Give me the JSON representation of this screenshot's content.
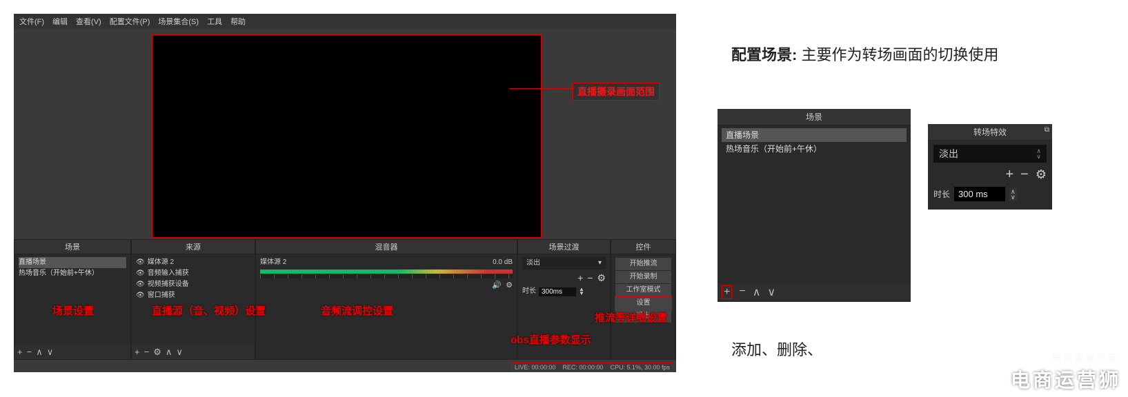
{
  "menu": [
    "文件(F)",
    "编辑",
    "查看(V)",
    "配置文件(P)",
    "场景集合(S)",
    "工具",
    "帮助"
  ],
  "annotations": {
    "preview_range": "直播摄录画面范围",
    "scenes": "场景设置",
    "sources": "直播源（音、视频）设置",
    "mixer": "音频流调控设置",
    "controls": "推流等详细设置",
    "status": "obs直播参数显示"
  },
  "panel_titles": {
    "scenes": "场景",
    "sources": "来源",
    "mixer": "混音器",
    "transitions": "场景过渡",
    "controls": "控件"
  },
  "scenes": {
    "items": [
      "直播场景",
      "热场音乐（开始前+午休）"
    ],
    "active_index": 0
  },
  "sources": {
    "items": [
      {
        "name": "媒体源 2",
        "visible": true
      },
      {
        "name": "音频输入捕获",
        "visible": true
      },
      {
        "name": "视频捕获设备",
        "visible": true
      },
      {
        "name": "窗口捕获",
        "visible": true
      }
    ]
  },
  "mixer": {
    "track_label": "媒体源 2",
    "level": "0.0 dB"
  },
  "transitions": {
    "selected": "淡出",
    "duration_label": "时长",
    "duration_value": "300ms"
  },
  "controls": {
    "buttons": [
      "开始推流",
      "开始录制",
      "工作室模式",
      "设置",
      "退出"
    ],
    "highlight_index": 3
  },
  "statusbar": {
    "live": "LIVE: 00:00:00",
    "rec": "REC: 00:00:00",
    "cpu": "CPU: 5.1%, 30.00 fps"
  },
  "right": {
    "title_bold": "配置场景:",
    "title_rest": " 主要作为转场画面的切换使用",
    "scenes_panel": {
      "title": "场景",
      "items": [
        "直播场景",
        "热场音乐（开始前+午休）"
      ]
    },
    "trans_panel": {
      "title": "转场特效",
      "selected": "淡出",
      "duration_label": "时长",
      "duration_value": "300 ms"
    },
    "footnote": "添加、删除、",
    "watermark_sub": "电商卖家助手",
    "watermark": "电商运营狮"
  }
}
